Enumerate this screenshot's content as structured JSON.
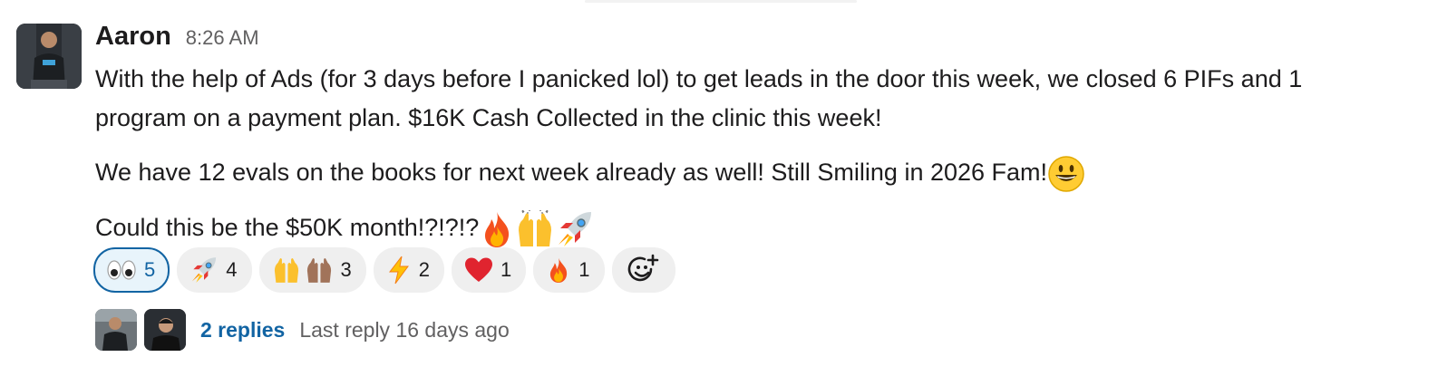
{
  "message": {
    "sender": "Aaron",
    "time": "8:26 AM",
    "paragraphs": [
      "With the help of Ads (for 3 days before I panicked lol) to get leads in the door this week, we closed 6 PIFs and 1",
      "program on a payment plan. $16K Cash Collected in the clinic this week!",
      "We have 12 evals on the books for next week already as well!  Still Smiling in 2026 Fam!",
      "Could this be the $50K month!?!?!?"
    ],
    "inline_emojis": [
      "grinning-face",
      "fire",
      "raised-hands",
      "rocket"
    ]
  },
  "reactions": [
    {
      "emoji": "eyes",
      "count": "5",
      "active": true
    },
    {
      "emoji": "rocket",
      "count": "4",
      "active": false
    },
    {
      "emoji": "raised-hands",
      "count": "3",
      "active": false
    },
    {
      "emoji": "zap",
      "count": "2",
      "active": false
    },
    {
      "emoji": "red-heart",
      "count": "1",
      "active": false
    },
    {
      "emoji": "fire",
      "count": "1",
      "active": false
    }
  ],
  "thread": {
    "replies_label": "2 replies",
    "last_reply": "Last reply 16 days ago"
  },
  "colors": {
    "link": "#1264a3",
    "active_reaction_bg": "#e8f4fb",
    "pill_bg": "#efefef",
    "muted": "#616061"
  }
}
